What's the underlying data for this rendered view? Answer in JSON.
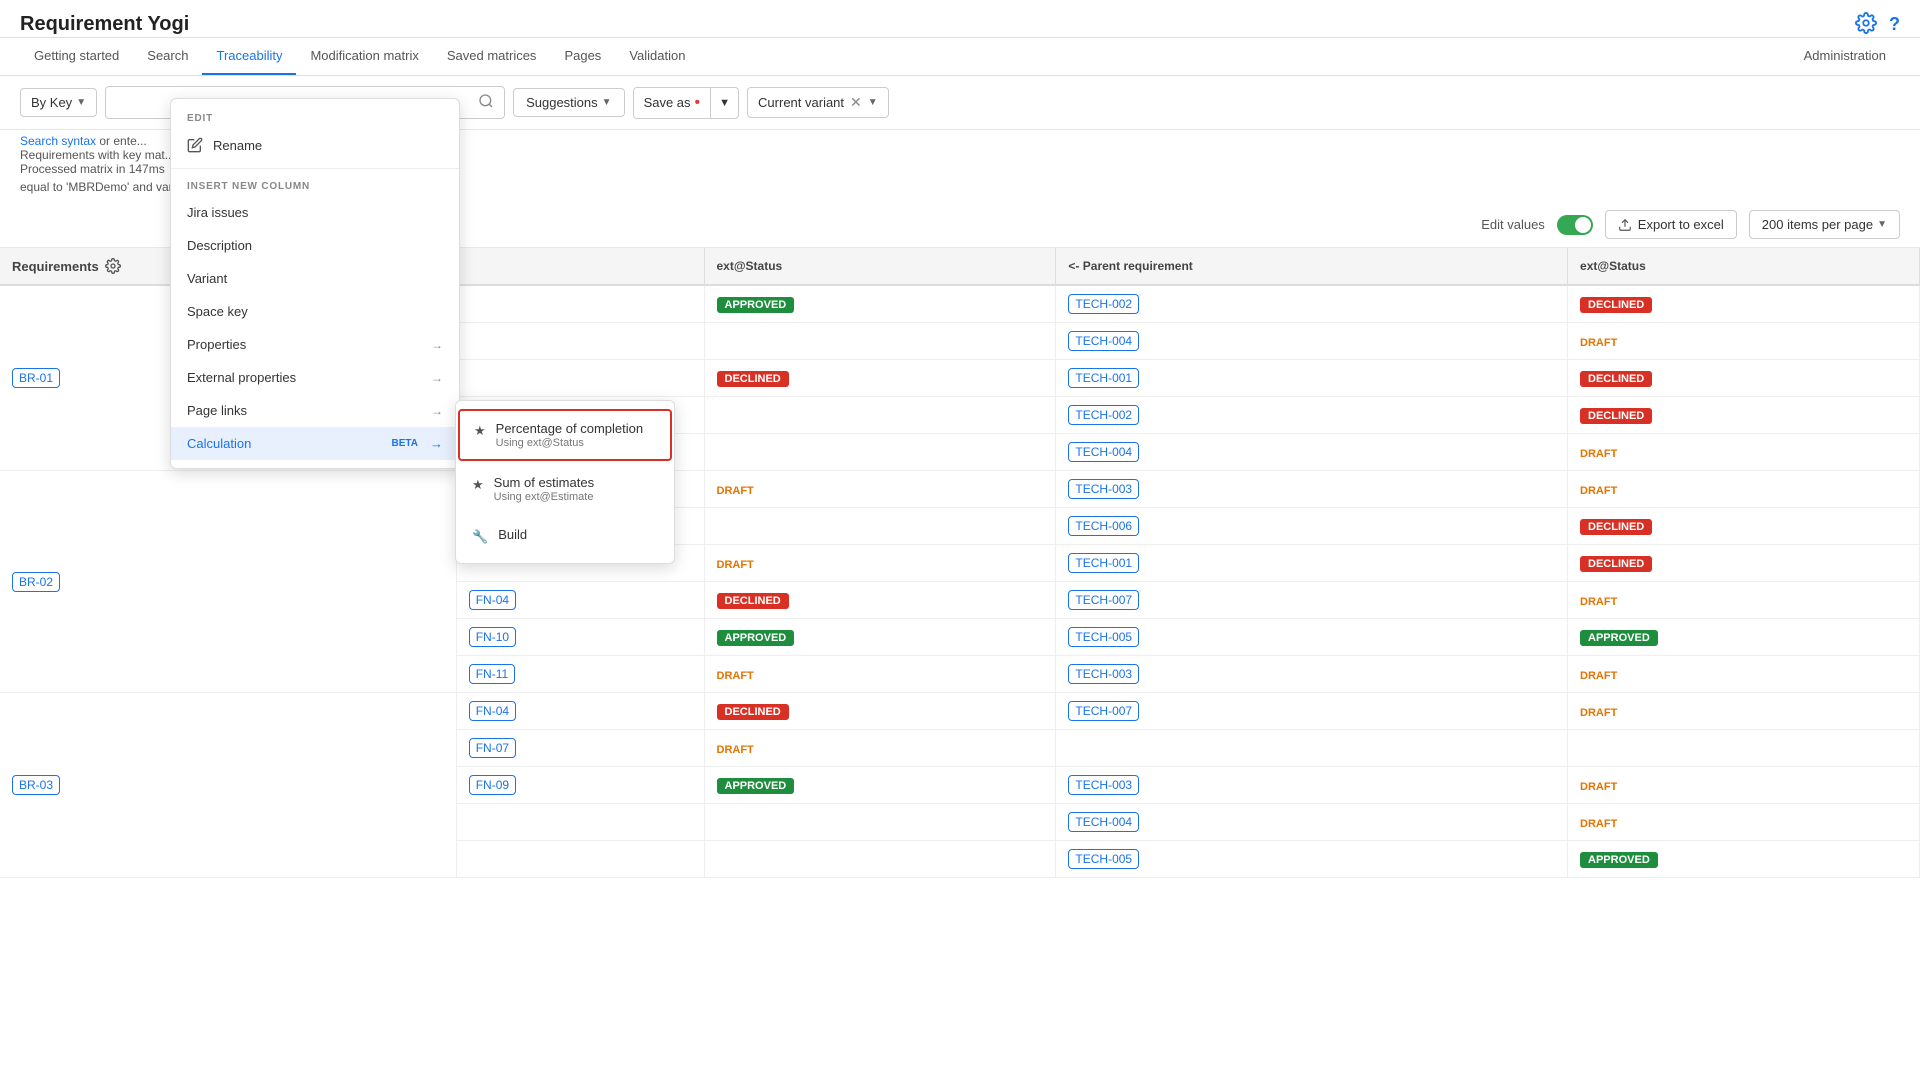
{
  "app": {
    "title": "Requirement Yogi"
  },
  "nav": {
    "items": [
      {
        "label": "Getting started",
        "active": false
      },
      {
        "label": "Search",
        "active": false
      },
      {
        "label": "Traceability",
        "active": true
      },
      {
        "label": "Modification matrix",
        "active": false
      },
      {
        "label": "Saved matrices",
        "active": false
      },
      {
        "label": "Pages",
        "active": false
      },
      {
        "label": "Validation",
        "active": false
      }
    ],
    "admin": "Administration"
  },
  "toolbar": {
    "filter_label": "By Key",
    "search_placeholder": "",
    "suggestions_label": "Suggestions",
    "save_as_label": "Save as",
    "save_as_dot": "•",
    "current_variant_label": "Current variant"
  },
  "info_bar": {
    "line1": "See Search syntax or ente...",
    "line2": "Requirements with key mat...",
    "line3": "Processed matrix in 147ms",
    "result_text": "equal to 'MBRDemo' and variant is 23713 - 1 – 3 of 3 results"
  },
  "table_toolbar": {
    "edit_values_label": "Edit values",
    "export_label": "Export to excel",
    "items_per_page": "200 items per page"
  },
  "table": {
    "columns": [
      "Requirements",
      "",
      "ext@Status",
      "<- Parent requirement",
      "ext@Status"
    ],
    "rows": [
      {
        "req": "BR-01",
        "children": [
          {
            "fn": "",
            "status": "APPROVED",
            "parent": "TECH-002",
            "parent_status": "DECLINED"
          },
          {
            "fn": "",
            "status": "",
            "parent": "TECH-004",
            "parent_status": "DRAFT"
          },
          {
            "fn": "",
            "status": "DECLINED",
            "parent": "TECH-001",
            "parent_status": "DECLINED"
          },
          {
            "fn": "",
            "status": "",
            "parent": "TECH-002",
            "parent_status": "DECLINED"
          },
          {
            "fn": "",
            "status": "",
            "parent": "TECH-004",
            "parent_status": "DRAFT"
          }
        ]
      },
      {
        "req": "BR-02",
        "children": [
          {
            "fn": "",
            "status": "DRAFT",
            "parent": "TECH-003",
            "parent_status": "DRAFT"
          },
          {
            "fn": "",
            "status": "",
            "parent": "TECH-006",
            "parent_status": "DECLINED"
          },
          {
            "fn": "",
            "status": "DRAFT",
            "parent": "TECH-001",
            "parent_status": "DECLINED"
          },
          {
            "fn": "FN-04",
            "status": "DECLINED",
            "parent": "TECH-007",
            "parent_status": "DRAFT"
          },
          {
            "fn": "FN-10",
            "status": "APPROVED",
            "parent": "TECH-005",
            "parent_status": "APPROVED"
          },
          {
            "fn": "FN-11",
            "status": "DRAFT",
            "parent": "TECH-003",
            "parent_status": "DRAFT"
          }
        ]
      },
      {
        "req": "BR-03",
        "children": [
          {
            "fn": "FN-04",
            "status": "DECLINED",
            "parent": "TECH-007",
            "parent_status": "DRAFT"
          },
          {
            "fn": "FN-07",
            "status": "DRAFT",
            "parent": "",
            "parent_status": ""
          },
          {
            "fn": "FN-09",
            "status": "APPROVED",
            "parent": "TECH-003",
            "parent_status": "DRAFT"
          },
          {
            "fn": "",
            "status": "",
            "parent": "TECH-004",
            "parent_status": "DRAFT"
          },
          {
            "fn": "",
            "status": "",
            "parent": "TECH-005",
            "parent_status": "APPROVED"
          }
        ]
      }
    ]
  },
  "edit_menu": {
    "section_edit": "EDIT",
    "rename_label": "Rename",
    "section_insert": "INSERT NEW COLUMN",
    "items": [
      {
        "label": "Jira issues",
        "has_arrow": false
      },
      {
        "label": "Description",
        "has_arrow": false
      },
      {
        "label": "Variant",
        "has_arrow": false
      },
      {
        "label": "Space key",
        "has_arrow": false
      },
      {
        "label": "Properties",
        "has_arrow": true
      },
      {
        "label": "External properties",
        "has_arrow": true
      },
      {
        "label": "Page links",
        "has_arrow": true
      },
      {
        "label": "Calculation",
        "has_arrow": true,
        "is_beta": true,
        "is_active": true
      }
    ]
  },
  "sub_menu": {
    "items": [
      {
        "label": "Percentage of completion",
        "sub": "Using ext@Status",
        "highlighted": true
      },
      {
        "label": "Sum of estimates",
        "sub": "Using ext@Estimate",
        "highlighted": false
      },
      {
        "label": "Build",
        "sub": "",
        "highlighted": false
      }
    ]
  }
}
